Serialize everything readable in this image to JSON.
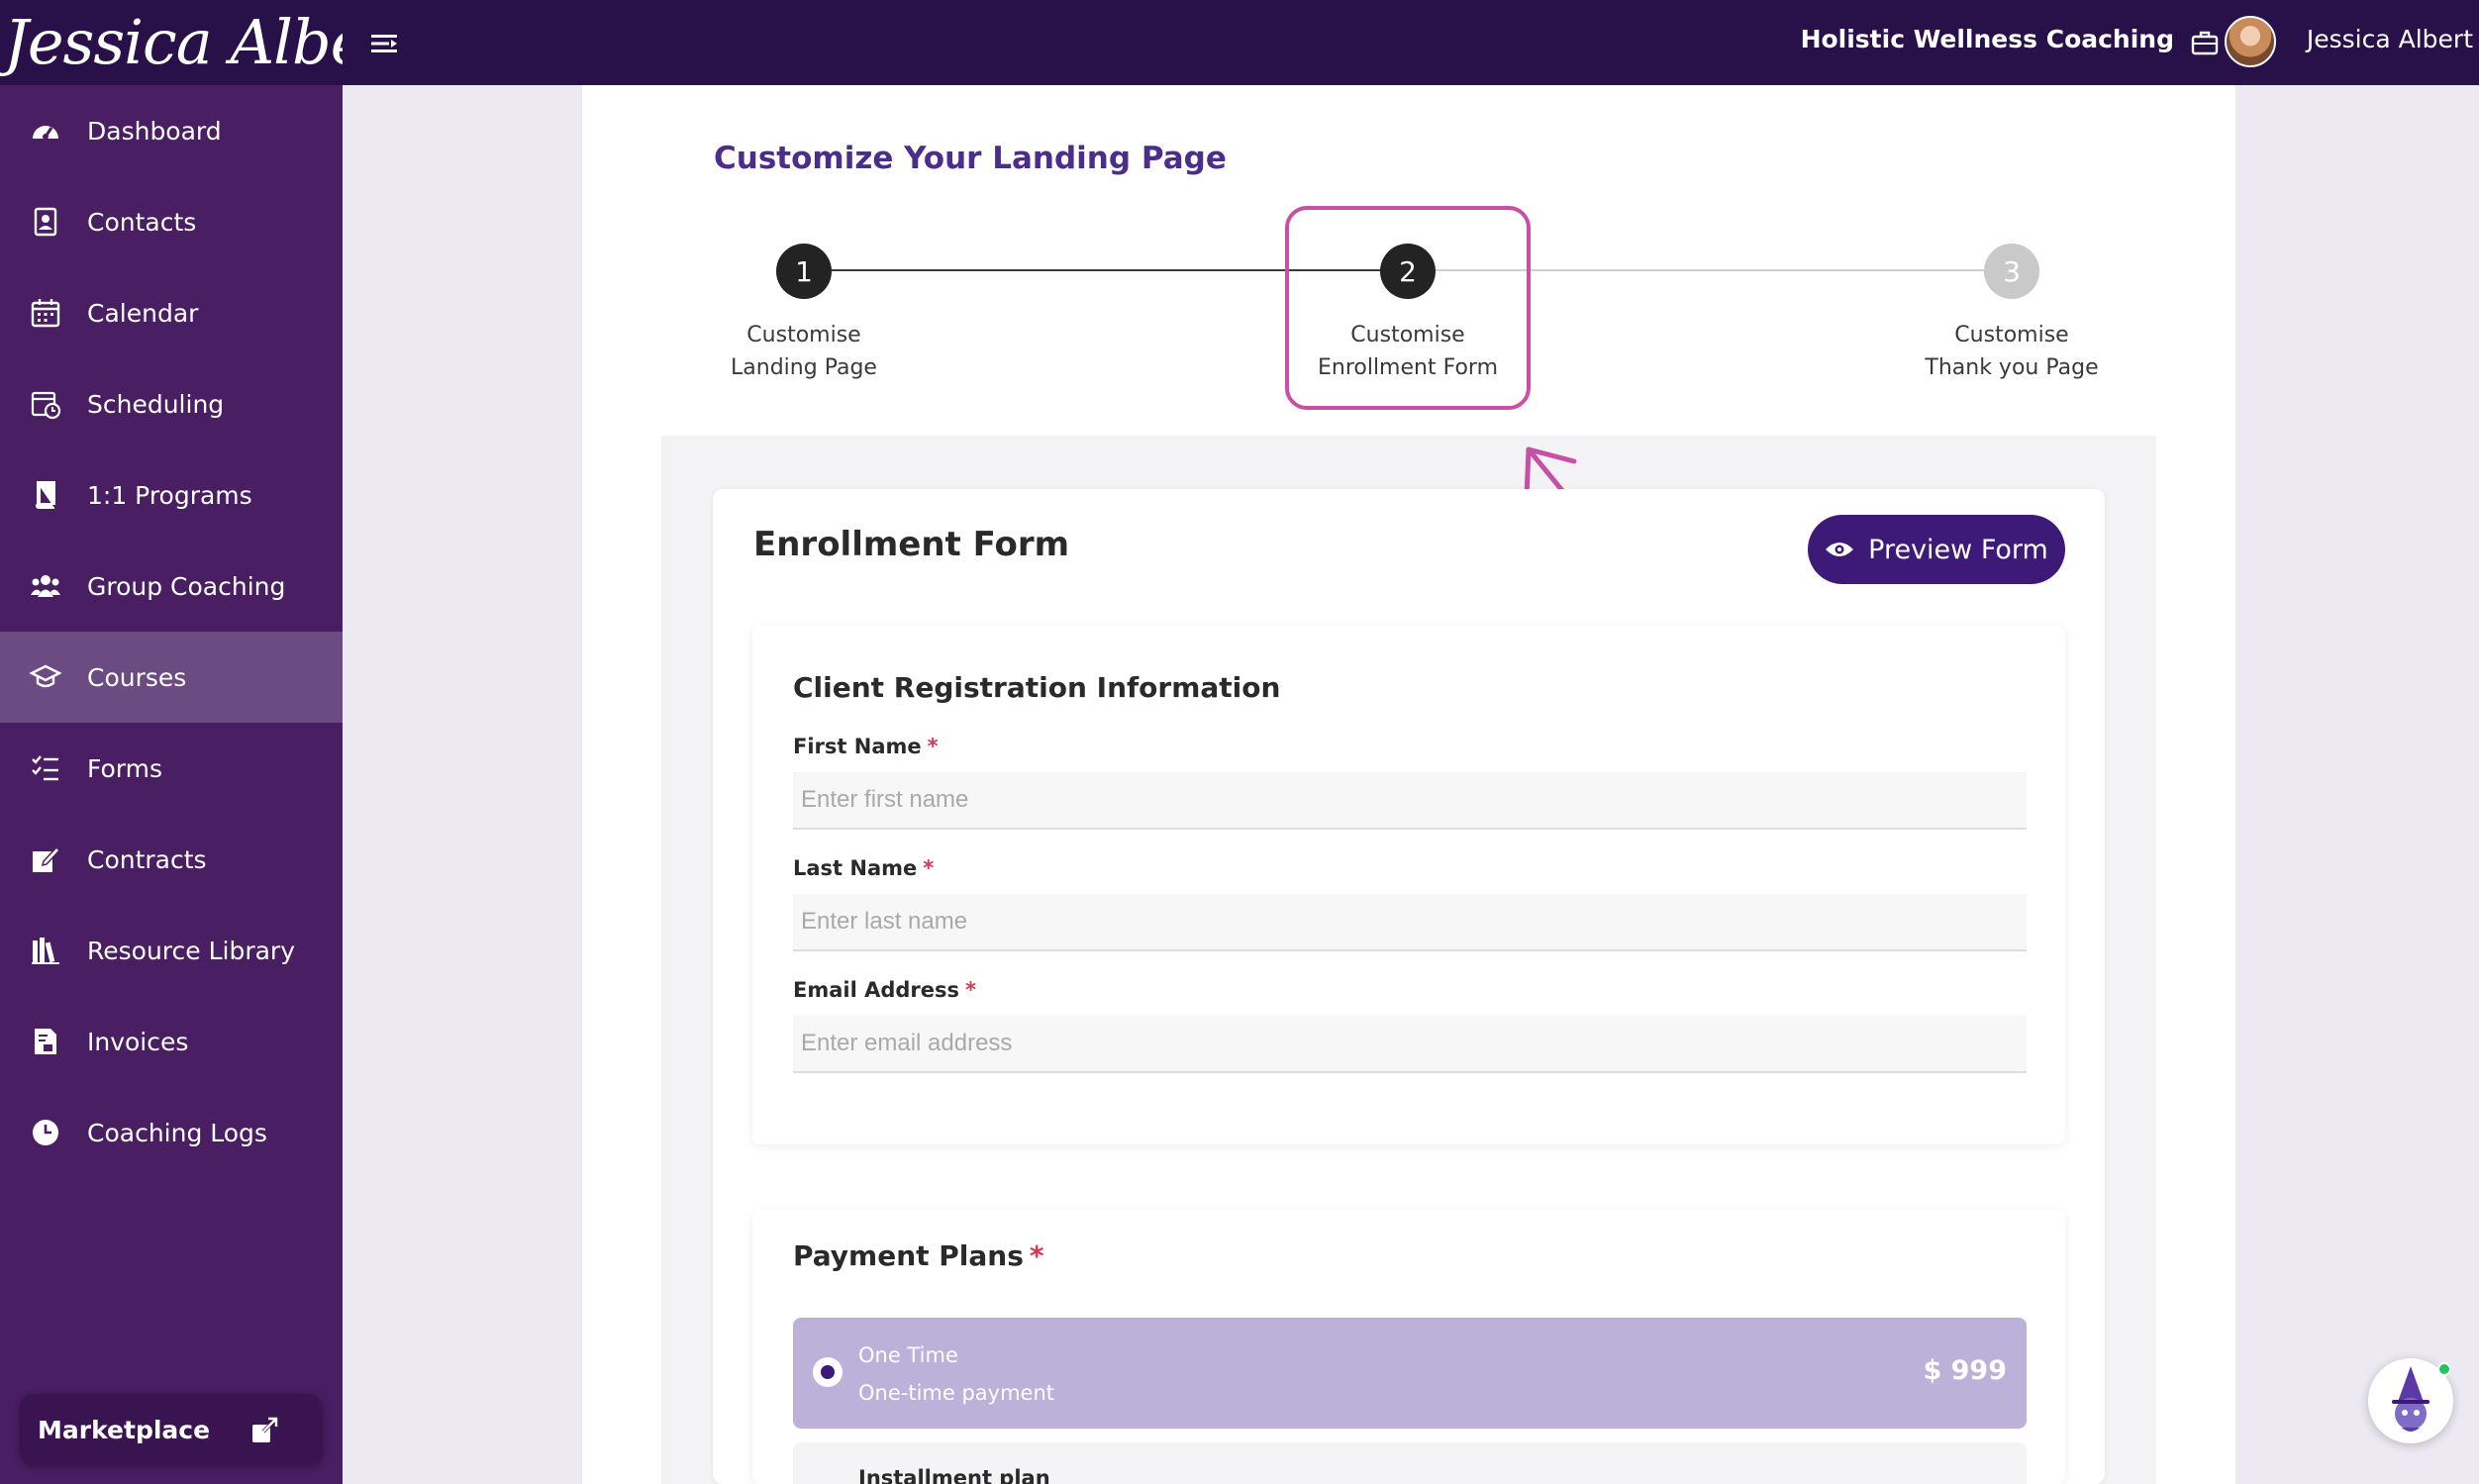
{
  "header": {
    "logo_text": "Jessica Albert",
    "business_name": "Holistic Wellness Coaching",
    "user_name": "Jessica Albert"
  },
  "sidebar": {
    "items": [
      {
        "label": "Dashboard",
        "icon": "dashboard-icon"
      },
      {
        "label": "Contacts",
        "icon": "contacts-icon"
      },
      {
        "label": "Calendar",
        "icon": "calendar-icon"
      },
      {
        "label": "Scheduling",
        "icon": "scheduling-icon"
      },
      {
        "label": "1:1 Programs",
        "icon": "book-icon"
      },
      {
        "label": "Group Coaching",
        "icon": "group-icon"
      },
      {
        "label": "Courses",
        "icon": "graduation-cap-icon",
        "active": true
      },
      {
        "label": "Forms",
        "icon": "checklist-icon"
      },
      {
        "label": "Contracts",
        "icon": "pen-edit-icon"
      },
      {
        "label": "Resource Library",
        "icon": "library-icon"
      },
      {
        "label": "Invoices",
        "icon": "invoice-icon"
      },
      {
        "label": "Coaching Logs",
        "icon": "clock-icon"
      }
    ],
    "marketplace_label": "Marketplace"
  },
  "page": {
    "title": "Customize Your Landing Page"
  },
  "stepper": {
    "steps": [
      {
        "number": "1",
        "line1": "Customise",
        "line2": "Landing Page",
        "state": "complete"
      },
      {
        "number": "2",
        "line1": "Customise",
        "line2": "Enrollment Form",
        "state": "current"
      },
      {
        "number": "3",
        "line1": "Customise",
        "line2": "Thank you Page",
        "state": "upcoming"
      }
    ]
  },
  "form": {
    "title": "Enrollment Form",
    "preview_label": "Preview Form",
    "registration": {
      "heading": "Client Registration Information",
      "fields": [
        {
          "label": "First Name",
          "required": "*",
          "placeholder": "Enter first name",
          "value": ""
        },
        {
          "label": "Last Name",
          "required": "*",
          "placeholder": "Enter last name",
          "value": ""
        },
        {
          "label": "Email Address",
          "required": "*",
          "placeholder": "Enter email address",
          "value": ""
        }
      ]
    },
    "payment": {
      "heading": "Payment Plans",
      "required": "*",
      "plans": [
        {
          "name": "One Time",
          "description": "One-time payment",
          "price": "$ 999",
          "selected": true
        },
        {
          "name": "Installment plan"
        }
      ]
    }
  },
  "colors": {
    "header_bg": "#281148",
    "sidebar_bg": "#4a1e62",
    "sidebar_active": "#6c4a82",
    "accent": "#3e1a78",
    "title": "#4b2d8c",
    "highlight": "#c94fa5",
    "selected_plan": "#bcb1d8"
  }
}
